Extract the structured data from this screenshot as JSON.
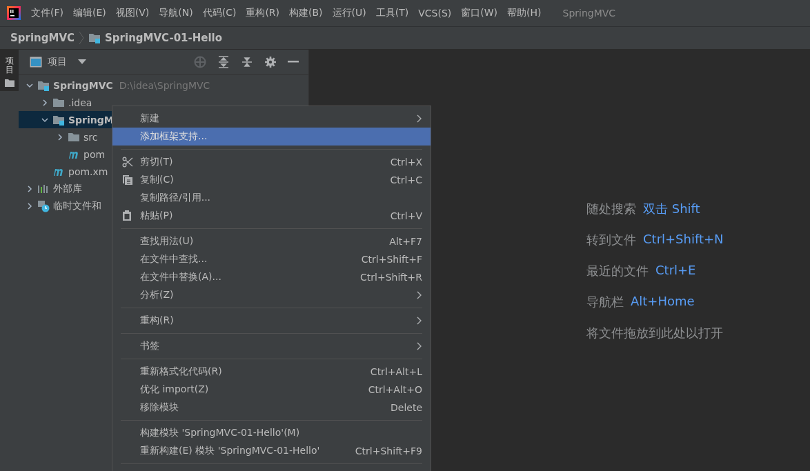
{
  "menu_bar": {
    "items": [
      {
        "label": "文件(F)"
      },
      {
        "label": "编辑(E)"
      },
      {
        "label": "视图(V)"
      },
      {
        "label": "导航(N)"
      },
      {
        "label": "代码(C)"
      },
      {
        "label": "重构(R)"
      },
      {
        "label": "构建(B)"
      },
      {
        "label": "运行(U)"
      },
      {
        "label": "工具(T)"
      },
      {
        "label": "VCS(S)"
      },
      {
        "label": "窗口(W)"
      },
      {
        "label": "帮助(H)"
      }
    ],
    "title": "SpringMVC"
  },
  "breadcrumb": [
    "SpringMVC",
    "SpringMVC-01-Hello"
  ],
  "side_strip": {
    "tab": "项目"
  },
  "project_panel": {
    "title": "项目",
    "tree": [
      {
        "label": "SpringMVC",
        "kind": "module",
        "path": "D:\\idea\\SpringMVC",
        "expanded": true,
        "selected": false,
        "children": [
          {
            "label": ".idea",
            "kind": "folder",
            "expanded": false,
            "selected": false
          },
          {
            "label": "SpringM",
            "kind": "module",
            "expanded": true,
            "selected": true,
            "children": [
              {
                "label": "src",
                "kind": "folder",
                "expanded": false,
                "selected": false
              },
              {
                "label": "pom",
                "kind": "maven",
                "selected": false
              }
            ]
          },
          {
            "label": "pom.xm",
            "kind": "maven",
            "selected": false
          }
        ]
      },
      {
        "label": "外部库",
        "kind": "library",
        "expanded": false,
        "selected": false
      },
      {
        "label": "临时文件和",
        "kind": "scratch",
        "expanded": false,
        "selected": false
      }
    ]
  },
  "context_menu": [
    {
      "kind": "plain",
      "label": "新建",
      "submenu": true,
      "selected": false
    },
    {
      "kind": "plain",
      "label": "添加框架支持...",
      "submenu": false,
      "selected": true
    },
    {
      "kind": "separator"
    },
    {
      "kind": "cut",
      "label": "剪切(T)",
      "shortcut": "Ctrl+X",
      "submenu": false,
      "selected": false
    },
    {
      "kind": "copy",
      "label": "复制(C)",
      "shortcut": "Ctrl+C",
      "submenu": false,
      "selected": false
    },
    {
      "kind": "plain",
      "label": "复制路径/引用...",
      "submenu": false,
      "selected": false
    },
    {
      "kind": "paste",
      "label": "粘贴(P)",
      "shortcut": "Ctrl+V",
      "submenu": false,
      "selected": false
    },
    {
      "kind": "separator"
    },
    {
      "kind": "plain",
      "label": "查找用法(U)",
      "shortcut": "Alt+F7",
      "submenu": false,
      "selected": false
    },
    {
      "kind": "plain",
      "label": "在文件中查找...",
      "shortcut": "Ctrl+Shift+F",
      "submenu": false,
      "selected": false
    },
    {
      "kind": "plain",
      "label": "在文件中替换(A)...",
      "shortcut": "Ctrl+Shift+R",
      "submenu": false,
      "selected": false
    },
    {
      "kind": "plain",
      "label": "分析(Z)",
      "submenu": true,
      "selected": false
    },
    {
      "kind": "separator"
    },
    {
      "kind": "plain",
      "label": "重构(R)",
      "submenu": true,
      "selected": false
    },
    {
      "kind": "separator"
    },
    {
      "kind": "plain",
      "label": "书签",
      "submenu": true,
      "selected": false
    },
    {
      "kind": "separator"
    },
    {
      "kind": "plain",
      "label": "重新格式化代码(R)",
      "shortcut": "Ctrl+Alt+L",
      "submenu": false,
      "selected": false
    },
    {
      "kind": "plain",
      "label": "优化 import(Z)",
      "shortcut": "Ctrl+Alt+O",
      "submenu": false,
      "selected": false
    },
    {
      "kind": "plain",
      "label": "移除模块",
      "shortcut": "Delete",
      "submenu": false,
      "selected": false
    },
    {
      "kind": "separator"
    },
    {
      "kind": "plain",
      "label": "构建模块 'SpringMVC-01-Hello'(M)",
      "submenu": false,
      "selected": false
    },
    {
      "kind": "plain",
      "label": "重新构建(E) 模块 'SpringMVC-01-Hello'",
      "shortcut": "Ctrl+Shift+F9",
      "submenu": false,
      "selected": false
    },
    {
      "kind": "separator"
    }
  ],
  "editor_hints": [
    {
      "label": "随处搜索",
      "shortcut": "双击 Shift"
    },
    {
      "label": "转到文件",
      "shortcut": "Ctrl+Shift+N"
    },
    {
      "label": "最近的文件",
      "shortcut": "Ctrl+E"
    },
    {
      "label": "导航栏",
      "shortcut": "Alt+Home"
    },
    {
      "label": "将文件拖放到此处以打开"
    }
  ]
}
